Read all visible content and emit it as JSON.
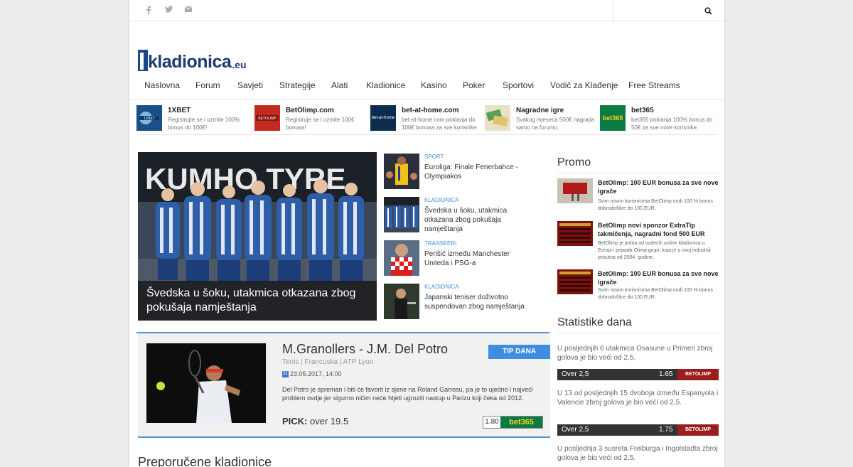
{
  "header": {
    "social": [
      "facebook-icon",
      "twitter-icon",
      "envelope-icon"
    ],
    "search_icon": "search-icon"
  },
  "logo": {
    "main": "kladionica",
    "suffix": ".eu"
  },
  "nav": {
    "items": [
      "Naslovna",
      "Forum",
      "Savjeti",
      "Strategije",
      "Alati",
      "Kladionice",
      "Kasino",
      "Poker",
      "Sportovi",
      "Vodič za Klađenje",
      "Free Streams"
    ]
  },
  "sponsors": [
    {
      "name": "1XBET",
      "desc": "Registrujte se i uzmite 100% bonus do 100€!"
    },
    {
      "name": "BetOlimp.com",
      "desc": "Registruje se i uzmite 100€ bonusa!"
    },
    {
      "name": "bet-at-home.com",
      "desc": "bet-at-home.com poklanja do 100€ bonusa za sve korisnike."
    },
    {
      "name": "Nagradne igre",
      "desc": "Svakog mjeseca 500€ nagrada samo na forumu."
    },
    {
      "name": "bet365",
      "desc": "bet365 poklanja 100% bonus do 50€ za sve nove korisnike."
    }
  ],
  "hero": {
    "caption": "Švedska u šoku, utakmica otkazana zbog pokušaja namještanja"
  },
  "side_news": [
    {
      "cat": "SPORT",
      "title": "Euroliga: Finale Fenerbahce - Olympiakos"
    },
    {
      "cat": "KLADIONICA",
      "title": "Švedska u šoku, utakmica otkazana zbog pokušaja namještanja"
    },
    {
      "cat": "TRANSFERI",
      "title": "Perišić između Manchester Uniteda i PSG-a"
    },
    {
      "cat": "KLADIONICA",
      "title": "Japanski teniser doživotno suspendovan zbog namještanja"
    }
  ],
  "tip": {
    "badge": "TIP DANA",
    "title": "M.Granollers - J.M. Del Potro",
    "meta": "Tenis | Francuska | ATP Lyon",
    "date": "23.05.2017, 14:00",
    "body": "Del Potro je spreman i biti će favorit iz sjene na Roland Garrosu, pa je to ujedno i najveći problem ovdje jer sigurno ničim neće htjeti ugroziti nastup u Parizu koji čeka od 2012.",
    "pick_label": "PICK:",
    "pick_value": "over 19.5",
    "odds": "1.80",
    "bookmaker": "bet365"
  },
  "recommended_title": "Preporučene kladionice",
  "promo": {
    "title": "Promo",
    "items": [
      {
        "title": "BetOlimp: 100 EUR bonusa za sve nove igrače",
        "desc": "Svim novim korisnicima BetOlimp nudi 100 % bonus dobrodošlice do 100 EUR."
      },
      {
        "title": "BetOlimp novi sponzor ExtraTip takmičenja, nagradni fond 500 EUR",
        "desc": "BetOlimp je jedna od vodećih online kladionica u Evropi i pripada Olimp grupi, koja je u ovoj industriji prisutna od 2004. godine."
      },
      {
        "title": "BetOlimp: 100 EUR bonusa za sve nove igrače",
        "desc": "Svim novim korisnicima BetOlimp nudi 100 % bonus dobrodošlice do 100 EUR."
      }
    ]
  },
  "stats": {
    "title": "Statistike dana",
    "items": [
      {
        "text": "U posljednjih 6 utakmica Osasune u Primeri zbroj golova je bio veći od 2,5.",
        "market": "Over 2,5",
        "odd": "1.65",
        "bookmaker": "BETOLIMP"
      },
      {
        "text": "U 13 od posljednjih 15 dvoboja između Espanyola i Valencie zbroj golova je bio veći od 2,5.",
        "market": "Over 2,5",
        "odd": "1.75",
        "bookmaker": "BETOLIMP"
      },
      {
        "text": "U posljednja 3 susreta Freiburga i Ingolstadta zbroj golova je bio veći od 2,5."
      }
    ]
  },
  "colors": {
    "accent": "#5c92d4",
    "brand": "#1e3b6e",
    "badge": "#3d8ee0",
    "bet365": "#0b7a43",
    "betolimp": "#9c1d1d"
  }
}
